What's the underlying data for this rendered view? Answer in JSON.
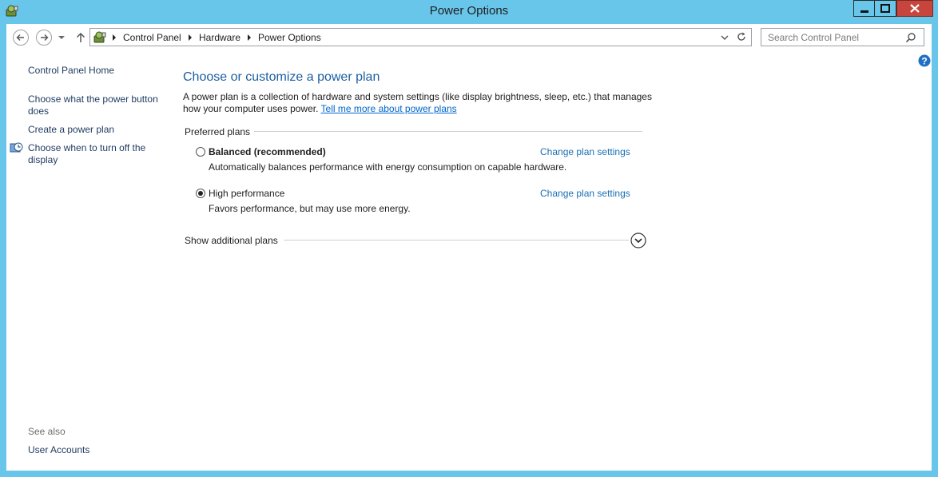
{
  "window": {
    "title": "Power Options",
    "controls": {
      "minimize_icon": "minimize-icon",
      "maximize_icon": "maximize-icon",
      "close_icon": "close-icon"
    }
  },
  "address_bar": {
    "breadcrumbs": [
      "Control Panel",
      "Hardware",
      "Power Options"
    ]
  },
  "search": {
    "placeholder": "Search Control Panel"
  },
  "sidebar": {
    "home": "Control Panel Home",
    "links": [
      "Choose what the power button does",
      "Create a power plan",
      "Choose when to turn off the display"
    ],
    "see_also_label": "See also",
    "see_also_links": [
      "User Accounts"
    ]
  },
  "main": {
    "heading": "Choose or customize a power plan",
    "description": "A power plan is a collection of hardware and system settings (like display brightness, sleep, etc.) that manages how your computer uses power.",
    "tell_more_link": "Tell me more about power plans",
    "preferred_label": "Preferred plans",
    "plans": [
      {
        "name": "Balanced (recommended)",
        "description": "Automatically balances performance with energy consumption on capable hardware.",
        "action": "Change plan settings",
        "selected": false
      },
      {
        "name": "High performance",
        "description": "Favors performance, but may use more energy.",
        "action": "Change plan settings",
        "selected": true
      }
    ],
    "additional_label": "Show additional plans"
  },
  "colors": {
    "accent": "#68c6ea",
    "heading": "#1e5fa0",
    "link": "#1a6fb5",
    "close": "#c7453c"
  }
}
